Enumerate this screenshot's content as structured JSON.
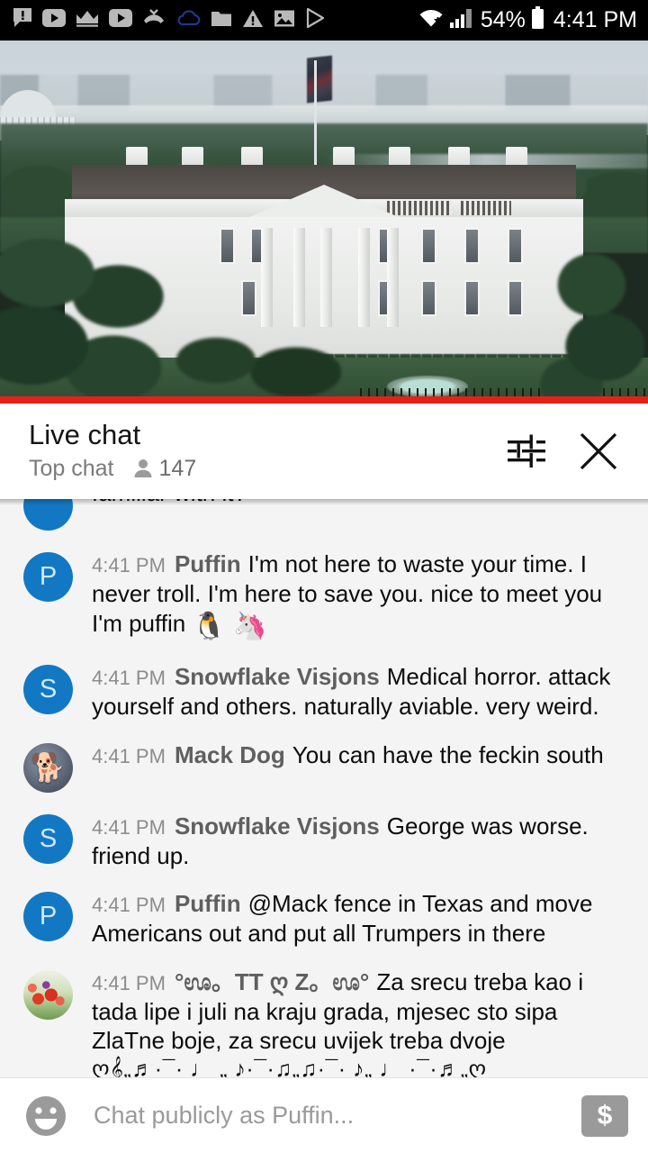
{
  "status_bar": {
    "icons": [
      "message-alert-icon",
      "youtube-icon",
      "crown-icon",
      "youtube-icon",
      "missed-call-icon",
      "cloud-icon",
      "folder-icon",
      "warning-icon",
      "photo-icon",
      "play-store-icon"
    ],
    "wifi_icon": "wifi-icon",
    "signal_icon": "signal-bars-icon",
    "battery_percent": "54%",
    "battery_icon": "battery-icon",
    "clock": "4:41 PM"
  },
  "video": {
    "title": "white-house-live-stream",
    "progress_bar_color": "#e52117",
    "progress_percent": 100
  },
  "chat_header": {
    "title": "Live chat",
    "mode": "Top chat",
    "viewer_icon": "person-icon",
    "viewer_count": "147",
    "settings_icon": "tune-sliders-icon",
    "close_icon": "close-icon"
  },
  "messages": [
    {
      "clipped": true,
      "time": "",
      "author": "",
      "avatar_type": "letter",
      "avatar_letter": "",
      "text": "familiar with it?"
    },
    {
      "clipped": false,
      "time": "4:41 PM",
      "author": "Puffin",
      "avatar_type": "letter",
      "avatar_letter": "P",
      "text": "I'm not here to waste your time. I never troll. I'm here to save you. nice to meet you I'm puffin ",
      "emoji": "🐧 🦄"
    },
    {
      "clipped": false,
      "time": "4:41 PM",
      "author": "Snowflake Visjons",
      "avatar_type": "letter",
      "avatar_letter": "S",
      "text": "Medical horror. attack yourself and others. naturally aviable. very weird."
    },
    {
      "clipped": false,
      "time": "4:41 PM",
      "author": "Mack Dog",
      "avatar_type": "dog",
      "avatar_letter": "",
      "text": "You can have the feckin south"
    },
    {
      "clipped": false,
      "time": "4:41 PM",
      "author": "Snowflake Visjons",
      "avatar_type": "letter",
      "avatar_letter": "S",
      "text": "George was worse. friend up."
    },
    {
      "clipped": false,
      "time": "4:41 PM",
      "author": "Puffin",
      "avatar_type": "letter",
      "avatar_letter": "P",
      "text": "@Mack fence in Texas and move Americans out and put all Trumpers in there"
    },
    {
      "clipped": false,
      "time": "4:41 PM",
      "author": "°ಊ。TT ღ Z。ಊ°",
      "avatar_type": "tulip",
      "avatar_letter": "",
      "text": "Za srecu treba kao i tada lipe i juli na kraju grada, mjesec sto sipa ZlaTne boje, za srecu uvijek treba dvoje",
      "notes": "ღ𝄞„♬·¯· ♩ „ ♪·¯·♫„♫·¯· ♪„ ♩ ·¯·♬„ღ"
    }
  ],
  "input_bar": {
    "emoji_icon": "emoji-smiley-icon",
    "placeholder": "Chat publicly as Puffin...",
    "value": "",
    "superchat_icon": "dollar-superchat-icon",
    "superchat_glyph": "$"
  },
  "colors": {
    "accent_blue": "#1278c4",
    "progress_red": "#e52117",
    "chat_bg": "#f4f4f4",
    "muted_text": "#8c8c8c"
  }
}
